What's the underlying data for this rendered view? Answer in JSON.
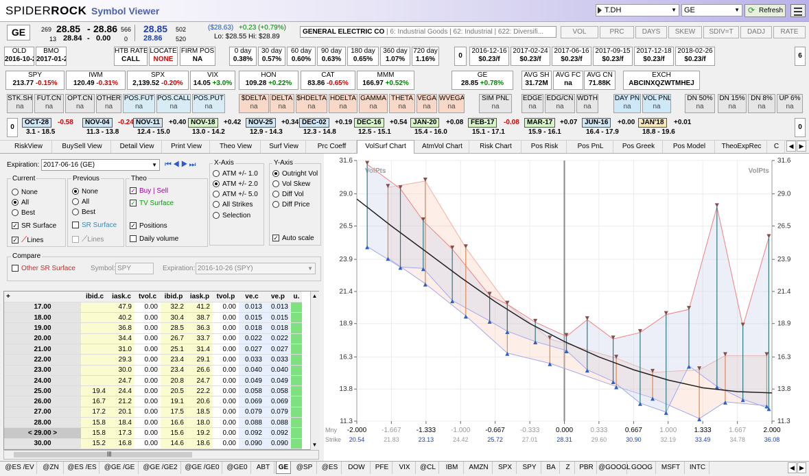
{
  "app": {
    "logo_a": "SPIDER",
    "logo_b": "ROCK",
    "title": "Symbol Viewer",
    "account": "T.DH",
    "symbol_select": "GE",
    "refresh": "Refresh"
  },
  "quote": {
    "symbol": "GE",
    "bid_size": "269",
    "bid": "28.85",
    "dash": "-",
    "ask": "28.86",
    "ask_size": "566",
    "bid2_size": "13",
    "bid2": "28.84",
    "dash2": "-",
    "ask2": "0.00",
    "ask2_size": "0",
    "last": "28.85",
    "last_size": "502",
    "last2": "28.86",
    "last2_size": "520",
    "chg1": "($28.63)",
    "chg2": "+0.23 (+0.79%)",
    "lohi": "Lo: $28.55  Hi: $28.89",
    "company": "GENERAL ELECTRIC CO",
    "sector": " | 6: Industrial Goods | 62: Industrial | 622: Diversifi...",
    "buttons": [
      "VOL",
      "PRC",
      "DAYS",
      "SKEW",
      "SDIV=T",
      "DADJ",
      "RATE"
    ]
  },
  "row2": {
    "cells": [
      {
        "h": "OLD",
        "v": "2016-10-21"
      },
      {
        "h": "BMO",
        "v": "2017-01-20"
      },
      {
        "h": "HTB RATE",
        "v": "CALL"
      },
      {
        "h": "LOCATE",
        "v": "NONE"
      },
      {
        "h": "FIRM POS",
        "v": "NA"
      },
      {
        "h": "0 day",
        "v": "0.38%"
      },
      {
        "h": "30 day",
        "v": "0.57%"
      },
      {
        "h": "60 day",
        "v": "0.60%"
      },
      {
        "h": "90 day",
        "v": "0.63%"
      },
      {
        "h": "180 day",
        "v": "0.65%"
      },
      {
        "h": "360 day",
        "v": "1.07%"
      },
      {
        "h": "720 day",
        "v": "1.16%"
      },
      {
        "h": "",
        "v": "0"
      },
      {
        "h": "2016-12-16",
        "v": "$0.23/f"
      },
      {
        "h": "2017-02-24",
        "v": "$0.23/f"
      },
      {
        "h": "2017-06-16",
        "v": "$0.23/f"
      },
      {
        "h": "2017-09-15",
        "v": "$0.23/f"
      },
      {
        "h": "2017-12-18",
        "v": "$0.23/f"
      },
      {
        "h": "2018-02-26",
        "v": "$0.23/f"
      },
      {
        "h": "",
        "v": "6"
      }
    ]
  },
  "row3": {
    "cells": [
      {
        "h": "SPY",
        "v": "213.77",
        "c": "-0.15%"
      },
      {
        "h": "IWM",
        "v": "120.49",
        "c": "-0.31%"
      },
      {
        "h": "SPX",
        "v": "2,139.52",
        "c": "-0.20%"
      },
      {
        "h": "VIX",
        "v": "14.05",
        "c": "+3.0%"
      },
      {
        "h": "HON",
        "v": "109.28",
        "c": "+0.22%"
      },
      {
        "h": "CAT",
        "v": "83.86",
        "c": "-0.65%"
      },
      {
        "h": "MMM",
        "v": "166.97",
        "c": "+0.52%"
      },
      {
        "h": "GE",
        "v": "28.85",
        "c": "+0.78%"
      },
      {
        "h": "AVG SH",
        "v": "31.72M",
        "c": ""
      },
      {
        "h": "AVG FC",
        "v": "na",
        "c": ""
      },
      {
        "h": "AVG CN",
        "v": "71.88K",
        "c": ""
      },
      {
        "h": "EXCH",
        "v": "ABCINXQZWTMHEJ",
        "c": ""
      }
    ]
  },
  "row4": {
    "cells": [
      "STK.SH",
      "FUT.CN",
      "OPT.CN",
      "OTHER",
      "POS.FUT",
      "POS.CALL",
      "POS.PUT",
      "$DELTA",
      "DELTA",
      "$HDELTA",
      "HDELTA",
      "GAMMA",
      "THETA",
      "VEGA",
      "WVEGA",
      "SIM PNL",
      "EDGE",
      "EDG/CN",
      "WDTH",
      "DAY PN",
      "VOL PNL",
      "DN 50%",
      "DN 15%",
      "DN 8%",
      "UP 6%"
    ],
    "na": "na"
  },
  "row5": {
    "left": "0",
    "right": "0",
    "items": [
      {
        "m": "OCT-28",
        "c": "-0.58",
        "r": "3.1 - 18.5"
      },
      {
        "m": "NOV-04",
        "c": "-0.24",
        "r": "11.3 - 13.8"
      },
      {
        "m": "NOV-11",
        "c": "+0.40",
        "r": "12.4 - 15.0"
      },
      {
        "m": "NOV-18",
        "c": "+0.42",
        "r": "13.0 - 14.2"
      },
      {
        "m": "NOV-25",
        "c": "+0.34",
        "r": "12.9 - 14.3"
      },
      {
        "m": "DEC-02",
        "c": "+0.19",
        "r": "12.3 - 14.8"
      },
      {
        "m": "DEC-16",
        "c": "+0.54",
        "r": "12.5 - 15.1"
      },
      {
        "m": "JAN-20",
        "c": "+0.08",
        "r": "15.4 - 16.0"
      },
      {
        "m": "FEB-17",
        "c": "-0.08",
        "r": "15.1 - 17.1"
      },
      {
        "m": "MAR-17",
        "c": "+0.07",
        "r": "15.9 - 16.1"
      },
      {
        "m": "JUN-16",
        "c": "+0.00",
        "r": "16.4 - 17.9"
      },
      {
        "m": "JAN'18",
        "c": "+0.01",
        "r": "18.8 - 19.6"
      }
    ]
  },
  "tabs": [
    "RiskView",
    "BuySell View",
    "Detail View",
    "Print View",
    "Theo View",
    "Surf View",
    "Prc Coeff",
    "VolSurf Chart",
    "AtmVol Chart",
    "Risk Chart",
    "Pos Risk",
    "Pos PnL",
    "Pos Greek",
    "Pos Model",
    "TheoExpRec",
    "C"
  ],
  "controls": {
    "expiration_label": "Expiration:",
    "expiration": "2017-06-16 (GE)",
    "current": "Current",
    "previous": "Previous",
    "theo": "Theo",
    "none": "None",
    "all": "All",
    "best": "Best",
    "sr_surface": "SR Surface",
    "lines": "Lines",
    "buy_sell": "Buy | Sell",
    "tv_surface": "TV Surface",
    "positions": "Positions",
    "daily_volume": "Daily volume",
    "xaxis": "X-Axis",
    "atm1": "ATM +/- 1.0",
    "atm2": "ATM +/- 2.0",
    "atm5": "ATM +/- 5.0",
    "all_strikes": "All Strikes",
    "selection": "Selection",
    "yaxis": "Y-Axis",
    "outright": "Outright Vol",
    "skew": "Vol Skew",
    "diffvol": "Diff Vol",
    "diffprice": "Diff Price",
    "autoscale": "Auto scale",
    "compare": "Compare",
    "other_sr": "Other SR Surface",
    "symbol_label": "Symbol:",
    "symbol_val": "SPY",
    "exp2_label": "Expiration:",
    "exp2_val": "2016-10-26 (SPY)"
  },
  "grid": {
    "plus": "+",
    "headers": [
      "ibid.c",
      "iask.c",
      "tvol.c",
      "ibid.p",
      "iask.p",
      "tvol.p",
      "ve.c",
      "ve.p",
      "u."
    ],
    "rows": [
      [
        "17.00",
        "",
        "47.9",
        "0.00",
        "32.2",
        "41.2",
        "0.00",
        "0.013",
        "0.013"
      ],
      [
        "18.00",
        "",
        "40.2",
        "0.00",
        "30.4",
        "38.7",
        "0.00",
        "0.015",
        "0.015"
      ],
      [
        "19.00",
        "",
        "36.8",
        "0.00",
        "28.5",
        "36.3",
        "0.00",
        "0.018",
        "0.018"
      ],
      [
        "20.00",
        "",
        "34.4",
        "0.00",
        "26.7",
        "33.7",
        "0.00",
        "0.022",
        "0.022"
      ],
      [
        "21.00",
        "",
        "31.0",
        "0.00",
        "25.1",
        "31.4",
        "0.00",
        "0.027",
        "0.027"
      ],
      [
        "22.00",
        "",
        "29.3",
        "0.00",
        "23.4",
        "29.1",
        "0.00",
        "0.033",
        "0.033"
      ],
      [
        "23.00",
        "",
        "30.0",
        "0.00",
        "23.4",
        "26.6",
        "0.00",
        "0.040",
        "0.040"
      ],
      [
        "24.00",
        "",
        "24.7",
        "0.00",
        "20.8",
        "24.7",
        "0.00",
        "0.049",
        "0.049"
      ],
      [
        "25.00",
        "19.4",
        "24.4",
        "0.00",
        "20.5",
        "22.2",
        "0.00",
        "0.058",
        "0.058"
      ],
      [
        "26.00",
        "16.7",
        "21.2",
        "0.00",
        "19.1",
        "20.6",
        "0.00",
        "0.069",
        "0.069"
      ],
      [
        "27.00",
        "17.2",
        "20.1",
        "0.00",
        "17.5",
        "18.5",
        "0.00",
        "0.079",
        "0.079"
      ],
      [
        "28.00",
        "15.8",
        "18.4",
        "0.00",
        "16.6",
        "18.0",
        "0.00",
        "0.088",
        "0.088"
      ],
      [
        "< 29.00 >",
        "15.8",
        "17.3",
        "0.00",
        "15.6",
        "19.2",
        "0.00",
        "0.092",
        "0.092"
      ],
      [
        "30.00",
        "15.2",
        "16.8",
        "0.00",
        "14.6",
        "18.6",
        "0.00",
        "0.090",
        "0.090"
      ]
    ]
  },
  "chart_data": {
    "type": "line",
    "title": "",
    "ylabel_left": "VolPts",
    "ylabel_right": "VolPts",
    "yticks": [
      "31.6",
      "29.0",
      "26.5",
      "23.9",
      "21.4",
      "18.9",
      "16.3",
      "13.8",
      "11.3"
    ],
    "ylim": [
      11.3,
      31.6
    ],
    "xlim": [
      -2,
      2
    ],
    "mny_label": "Mny",
    "strike_label": "Strike",
    "x_ticks": [
      "-2.000",
      "-1.667",
      "-1.333",
      "-1.000",
      "-0.667",
      "-0.333",
      "0.000",
      "0.333",
      "0.667",
      "1.000",
      "1.333",
      "1.667",
      "2.000"
    ],
    "strike_ticks": [
      "20.54",
      "21.83",
      "23.13",
      "24.42",
      "25.72",
      "27.01",
      "28.31",
      "29.60",
      "30.90",
      "32.19",
      "33.49",
      "34.78",
      "36.08"
    ],
    "theo_curve": [
      [
        -2,
        28.6
      ],
      [
        -1.667,
        26.5
      ],
      [
        -1.333,
        24.5
      ],
      [
        -1,
        22.5
      ],
      [
        -0.667,
        20.6
      ],
      [
        -0.333,
        18.9
      ],
      [
        0,
        17.5
      ],
      [
        0.333,
        16.3
      ],
      [
        0.667,
        15.3
      ],
      [
        1,
        14.5
      ],
      [
        1.333,
        13.9
      ],
      [
        1.667,
        13.6
      ],
      [
        2,
        13.5
      ]
    ],
    "calls": [
      {
        "x": -1.9,
        "bid": 24.9,
        "ask": 31.3
      },
      {
        "x": -1.58,
        "bid": 23.3,
        "ask": 29.4
      },
      {
        "x": -1.36,
        "bid": 23.2,
        "ask": 26.9
      },
      {
        "x": -1.08,
        "bid": 20.7,
        "ask": 24.7
      },
      {
        "x": -0.72,
        "bid": 19.1,
        "ask": 21.1
      },
      {
        "x": -0.55,
        "bid": 18.3,
        "ask": 20.4
      },
      {
        "x": -0.28,
        "bid": 17.5,
        "ask": 19.0
      },
      {
        "x": 0.02,
        "bid": 16.8,
        "ask": 17.9
      },
      {
        "x": 0.22,
        "bid": 15.3,
        "ask": 19.2
      },
      {
        "x": 0.47,
        "bid": 14.4,
        "ask": 17.7
      },
      {
        "x": 0.73,
        "bid": 12.7,
        "ask": 18.2
      },
      {
        "x": 0.98,
        "bid": 12.0,
        "ask": 19.6
      },
      {
        "x": 1.2,
        "bid": 15.6,
        "ask": 20.0
      },
      {
        "x": 1.47,
        "bid": 14.0,
        "ask": 28.0
      },
      {
        "x": 1.72,
        "bid": 13.0,
        "ask": 18.7
      },
      {
        "x": 1.97,
        "bid": 12.3,
        "ask": 25.6
      }
    ],
    "puts": [
      {
        "x": -1.7,
        "bid": 24.0,
        "ask": 29.5
      },
      {
        "x": -1.34,
        "bid": 22.0,
        "ask": 30.0
      },
      {
        "x": -0.95,
        "bid": 19.5,
        "ask": 24.8
      },
      {
        "x": -0.55,
        "bid": 16.6,
        "ask": 20.4
      },
      {
        "x": -0.14,
        "bid": 15.8,
        "ask": 17.7
      },
      {
        "x": 0.5,
        "bid": 14.0,
        "ask": 16.2
      },
      {
        "x": 0.85,
        "bid": 13.1,
        "ask": 15.1
      },
      {
        "x": 1.3,
        "bid": 11.5,
        "ask": 15.3
      },
      {
        "x": 1.55,
        "bid": 12.8,
        "ask": 16.4
      },
      {
        "x": 1.95,
        "bid": 12.5,
        "ask": 16.4
      }
    ]
  },
  "bottom_tabs": [
    "@ES /EV",
    "@ZN",
    "@ES /ES",
    "@GE /GE",
    "@GE /GE2",
    "@GE /GE0",
    "@GE0",
    "ABT",
    "GE",
    "@SP",
    "@ES",
    "DOW",
    "PFE",
    "VIX",
    "@CL",
    "IBM",
    "AMZN",
    "SPX",
    "SPY",
    "BA",
    "Z",
    "PBR",
    "@GOOGL",
    "GOOG",
    "MSFT",
    "INTC"
  ],
  "colors": {
    "accent": "#7a6ad8",
    "green": "#00a000",
    "red": "#e00000",
    "theo": "#202020",
    "calls_line": "#f08080",
    "puts_line": "#8090e0"
  }
}
